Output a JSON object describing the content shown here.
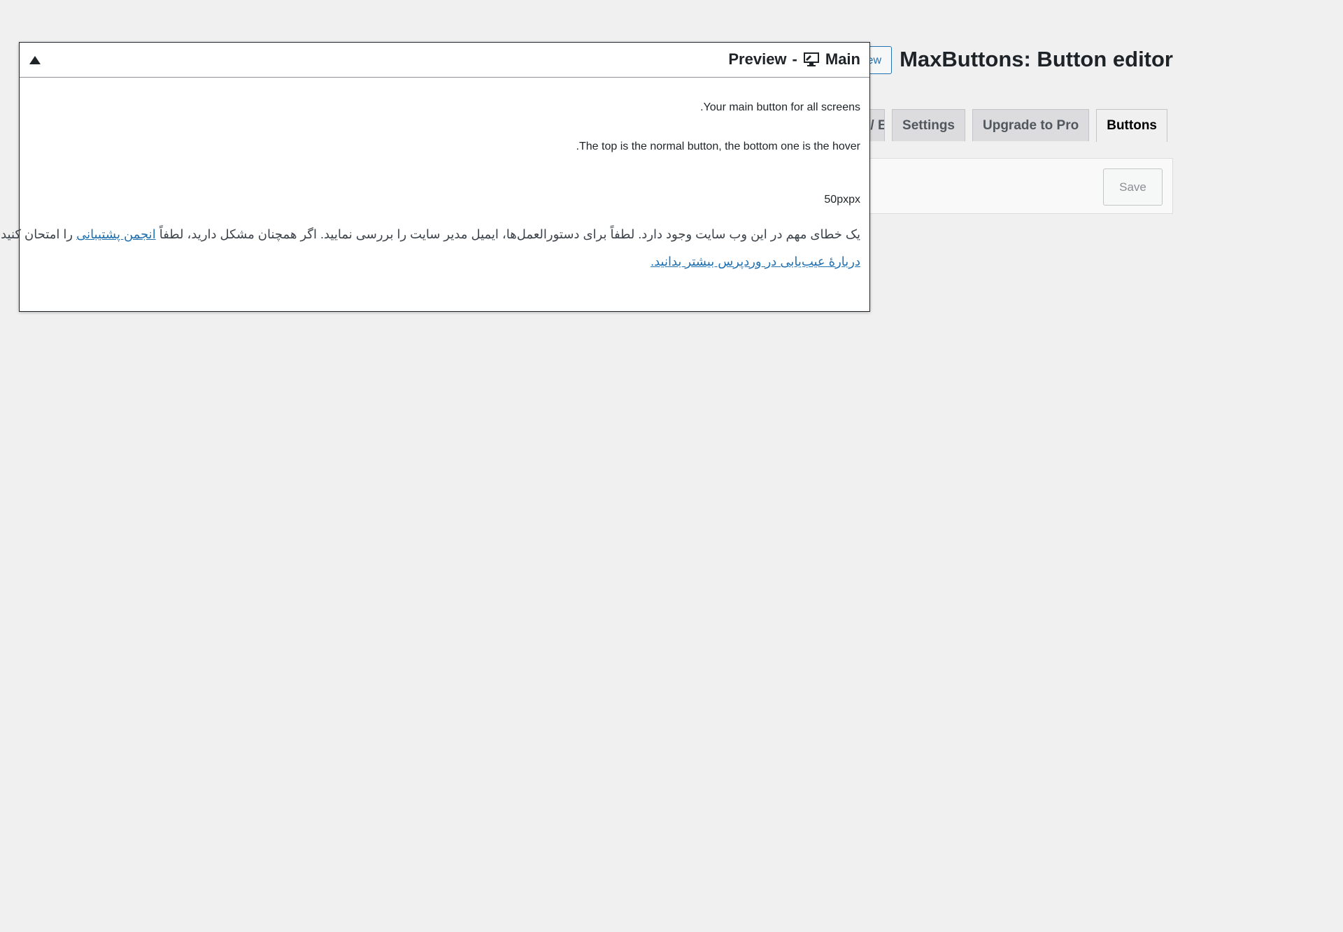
{
  "page": {
    "title": "MaxButtons: Button editor",
    "add_new_label": "Add New"
  },
  "tabs": [
    {
      "label": "Buttons",
      "active": true
    },
    {
      "label": "Upgrade to Pro",
      "active": false
    },
    {
      "label": "Settings",
      "active": false
    },
    {
      "label": "Import / Export",
      "active": false
    }
  ],
  "toolbar": {
    "save_label": "Save"
  },
  "preview": {
    "title_main": "Main",
    "title_sep": "-",
    "title_preview": "Preview",
    "desc_1": "Your main button for all screens.",
    "desc_2": "The top is the normal button, the bottom one is the hover.",
    "size_value": "50pxpx",
    "error_text_before": "یک خطای مهم در این وب سایت وجود دارد. لطفاً برای دستورالعمل‌ها، ایمیل مدیر سایت را بررسی نمایید. اگر همچنان مشکل دارید، لطفاً ",
    "error_link": "انجمن پشتیبانی",
    "error_text_after": " را امتحان کنید.",
    "help_link": "دربارهٔ عیب‌یابی در وردپرس بیشتر بدانید."
  },
  "colors": {
    "background": "#f0f0f1",
    "accent": "#2271b1"
  }
}
